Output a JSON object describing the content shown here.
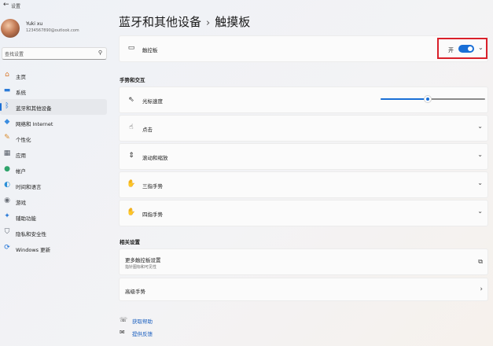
{
  "window": {
    "back_glyph": "←",
    "title": "设置"
  },
  "profile": {
    "name": "Yuki xu",
    "email": "1234567890@outlook.com"
  },
  "search": {
    "placeholder": "查找设置"
  },
  "sidebar": {
    "items": [
      {
        "label": "主页",
        "icon": "home-icon",
        "glyph": "⌂",
        "color": "#d9772a"
      },
      {
        "label": "系统",
        "icon": "monitor-icon",
        "glyph": "▬",
        "color": "#2b7bd8"
      },
      {
        "label": "蓝牙和其他设备",
        "icon": "bluetooth-icon",
        "glyph": "ᛒ",
        "color": "#1a6fd6",
        "active": true
      },
      {
        "label": "网络和 Internet",
        "icon": "wifi-icon",
        "glyph": "◆",
        "color": "#3b8de0"
      },
      {
        "label": "个性化",
        "icon": "brush-icon",
        "glyph": "✎",
        "color": "#d98a2a"
      },
      {
        "label": "应用",
        "icon": "apps-icon",
        "glyph": "▦",
        "color": "#555b66"
      },
      {
        "label": "帐户",
        "icon": "account-icon",
        "glyph": "●",
        "color": "#2fa36b"
      },
      {
        "label": "时间和语言",
        "icon": "globe-icon",
        "glyph": "◐",
        "color": "#2b8fd8"
      },
      {
        "label": "游戏",
        "icon": "gamepad-icon",
        "glyph": "◉",
        "color": "#6b7078"
      },
      {
        "label": "辅助功能",
        "icon": "accessibility-icon",
        "glyph": "✦",
        "color": "#2b7bd8"
      },
      {
        "label": "隐私和安全性",
        "icon": "shield-icon",
        "glyph": "⛉",
        "color": "#5b6470"
      },
      {
        "label": "Windows 更新",
        "icon": "update-icon",
        "glyph": "⟳",
        "color": "#1a6fd6"
      }
    ]
  },
  "breadcrumb": {
    "parent": "蓝牙和其他设备",
    "separator": "›",
    "current": "触摸板"
  },
  "touchpad": {
    "label": "触控板",
    "icon": "touchpad-icon",
    "toggle_label": "开",
    "toggle_on": true
  },
  "gestures": {
    "section_title": "手势和交互",
    "pointer_speed": {
      "label": "光标速度",
      "icon": "cursor-icon",
      "value_fraction": 0.45
    },
    "items": [
      {
        "label": "点击",
        "icon": "tap-icon"
      },
      {
        "label": "滚动和缩放",
        "icon": "scroll-icon"
      },
      {
        "label": "三指手势",
        "icon": "three-finger-icon"
      },
      {
        "label": "四指手势",
        "icon": "four-finger-icon"
      }
    ]
  },
  "related": {
    "section_title": "相关设置",
    "items": [
      {
        "label": "更多触控板设置",
        "sub": "指针图标和可见性",
        "icon": "external-link-icon"
      },
      {
        "label": "高级手势",
        "icon": "chevron-right-icon"
      }
    ]
  },
  "help": {
    "get_help": "获取帮助",
    "feedback": "提供反馈"
  },
  "colors": {
    "accent": "#1a6fd6",
    "highlight_border": "#d9202a"
  }
}
